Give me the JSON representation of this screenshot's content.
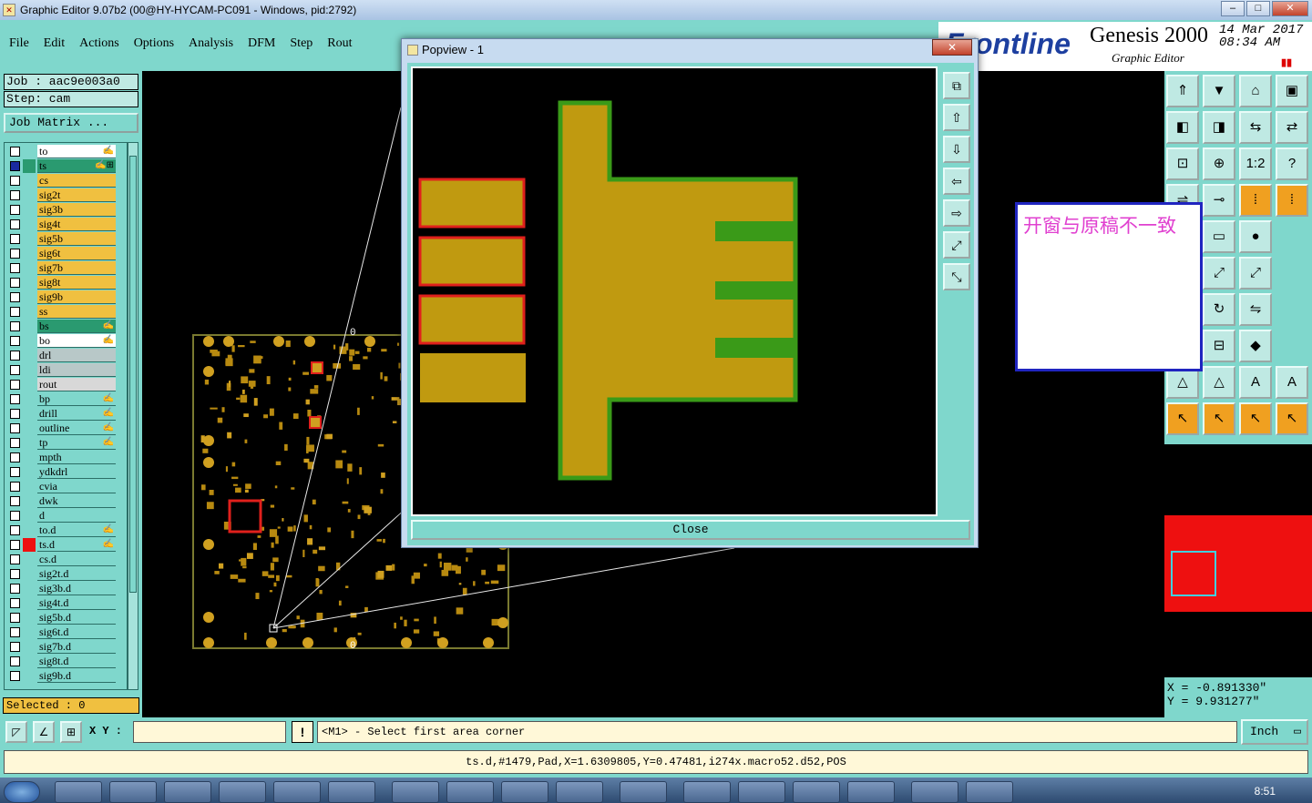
{
  "window": {
    "title": "Graphic Editor 9.07b2 (00@HY-HYCAM-PC091 - Windows, pid:2792)",
    "min_label": "–",
    "max_label": "□",
    "close_label": "✕"
  },
  "menu": {
    "items": [
      "File",
      "Edit",
      "Actions",
      "Options",
      "Analysis",
      "DFM",
      "Step",
      "Rout"
    ]
  },
  "brand": {
    "logo": "Frontline",
    "product": "Genesis 2000",
    "subtitle": "Graphic Editor",
    "date": "14 Mar 2017",
    "time": "08:34 AM"
  },
  "job": {
    "job_label": "Job : aac9e003a0",
    "step_label": "Step: cam",
    "matrix_button": "Job Matrix ..."
  },
  "layers": [
    {
      "name": "to",
      "bg": "#ffffff",
      "swatch": "",
      "checked": false,
      "mark": "✍"
    },
    {
      "name": "ts",
      "bg": "#2a9a70",
      "swatch": "#2a9a70",
      "checked": true,
      "mark": "✍⊞"
    },
    {
      "name": "cs",
      "bg": "#f0c040",
      "swatch": "",
      "checked": false,
      "mark": ""
    },
    {
      "name": "sig2t",
      "bg": "#f0c040",
      "swatch": "",
      "checked": false,
      "mark": ""
    },
    {
      "name": "sig3b",
      "bg": "#f0c040",
      "swatch": "",
      "checked": false,
      "mark": ""
    },
    {
      "name": "sig4t",
      "bg": "#f0c040",
      "swatch": "",
      "checked": false,
      "mark": ""
    },
    {
      "name": "sig5b",
      "bg": "#f0c040",
      "swatch": "",
      "checked": false,
      "mark": ""
    },
    {
      "name": "sig6t",
      "bg": "#f0c040",
      "swatch": "",
      "checked": false,
      "mark": ""
    },
    {
      "name": "sig7b",
      "bg": "#f0c040",
      "swatch": "",
      "checked": false,
      "mark": ""
    },
    {
      "name": "sig8t",
      "bg": "#f0c040",
      "swatch": "",
      "checked": false,
      "mark": ""
    },
    {
      "name": "sig9b",
      "bg": "#f0c040",
      "swatch": "",
      "checked": false,
      "mark": ""
    },
    {
      "name": "ss",
      "bg": "#f0c040",
      "swatch": "",
      "checked": false,
      "mark": ""
    },
    {
      "name": "bs",
      "bg": "#2a9a70",
      "swatch": "",
      "checked": false,
      "mark": "✍"
    },
    {
      "name": "bo",
      "bg": "#ffffff",
      "swatch": "",
      "checked": false,
      "mark": "✍"
    },
    {
      "name": "drl",
      "bg": "#b8c8c8",
      "swatch": "",
      "checked": false,
      "mark": ""
    },
    {
      "name": "ldi",
      "bg": "#b8c8c8",
      "swatch": "",
      "checked": false,
      "mark": ""
    },
    {
      "name": "rout",
      "bg": "#d8d8d8",
      "swatch": "",
      "checked": false,
      "mark": ""
    },
    {
      "name": "bp",
      "bg": "#7fd7cc",
      "swatch": "",
      "checked": false,
      "mark": "✍"
    },
    {
      "name": "drill",
      "bg": "#7fd7cc",
      "swatch": "",
      "checked": false,
      "mark": "✍"
    },
    {
      "name": "outline",
      "bg": "#7fd7cc",
      "swatch": "",
      "checked": false,
      "mark": "✍"
    },
    {
      "name": "tp",
      "bg": "#7fd7cc",
      "swatch": "",
      "checked": false,
      "mark": "✍"
    },
    {
      "name": "mpth",
      "bg": "#7fd7cc",
      "swatch": "",
      "checked": false,
      "mark": ""
    },
    {
      "name": "ydkdrl",
      "bg": "#7fd7cc",
      "swatch": "",
      "checked": false,
      "mark": ""
    },
    {
      "name": "cvia",
      "bg": "#7fd7cc",
      "swatch": "",
      "checked": false,
      "mark": ""
    },
    {
      "name": "dwk",
      "bg": "#7fd7cc",
      "swatch": "",
      "checked": false,
      "mark": ""
    },
    {
      "name": "d",
      "bg": "#7fd7cc",
      "swatch": "",
      "checked": false,
      "mark": ""
    },
    {
      "name": "to.d",
      "bg": "#7fd7cc",
      "swatch": "",
      "checked": false,
      "mark": "✍"
    },
    {
      "name": "ts.d",
      "bg": "#7fd7cc",
      "swatch": "#ee1010",
      "checked": false,
      "mark": "✍"
    },
    {
      "name": "cs.d",
      "bg": "#7fd7cc",
      "swatch": "",
      "checked": false,
      "mark": ""
    },
    {
      "name": "sig2t.d",
      "bg": "#7fd7cc",
      "swatch": "",
      "checked": false,
      "mark": ""
    },
    {
      "name": "sig3b.d",
      "bg": "#7fd7cc",
      "swatch": "",
      "checked": false,
      "mark": ""
    },
    {
      "name": "sig4t.d",
      "bg": "#7fd7cc",
      "swatch": "",
      "checked": false,
      "mark": ""
    },
    {
      "name": "sig5b.d",
      "bg": "#7fd7cc",
      "swatch": "",
      "checked": false,
      "mark": ""
    },
    {
      "name": "sig6t.d",
      "bg": "#7fd7cc",
      "swatch": "",
      "checked": false,
      "mark": ""
    },
    {
      "name": "sig7b.d",
      "bg": "#7fd7cc",
      "swatch": "",
      "checked": false,
      "mark": ""
    },
    {
      "name": "sig8t.d",
      "bg": "#7fd7cc",
      "swatch": "",
      "checked": false,
      "mark": ""
    },
    {
      "name": "sig9b.d",
      "bg": "#7fd7cc",
      "swatch": "",
      "checked": false,
      "mark": ""
    }
  ],
  "selected": "Selected : 0",
  "popup": {
    "title": "Popview - 1",
    "close_x": "✕",
    "close_button": "Close",
    "tools": [
      "zoom-fit-icon",
      "page-up-icon",
      "page-down-icon",
      "page-left-icon",
      "page-right-icon",
      "zoom-in-icon",
      "zoom-out-icon"
    ]
  },
  "board": {
    "origin_label_top": "0",
    "origin_label_bottom": "0"
  },
  "note": {
    "text": "开窗与原稿不一致"
  },
  "toolbar": {
    "icons": [
      "home-icon",
      "page-icon",
      "house-icon",
      "panel-icon",
      "move-left-icon",
      "move-right-icon",
      "step-icon",
      "swap-icon",
      "fit-icon",
      "center-icon",
      "one-to-one-icon",
      "help-icon",
      "filter-icon",
      "pad-icon",
      "measure-icon",
      "measure-red-icon",
      "line-icon",
      "ruler-icon",
      "dot-icon",
      "",
      "cross-icon",
      "snap-icon",
      "snap-blue-icon",
      "",
      "draw-line-icon",
      "rotate-icon",
      "mirror-icon",
      "",
      "minus-icon",
      "box-icon",
      "shape-icon",
      "",
      "triangle-icon",
      "triangle-up-icon",
      "a-icon",
      "a-right-icon",
      "pointer-icon",
      "pointer-box-icon",
      "pointer-circle-icon",
      "pointer-net-icon"
    ],
    "one_to_one_label": "1:2",
    "help_label": "?"
  },
  "coords": {
    "x": "X = -0.891330\"",
    "y": "Y = 9.931277\""
  },
  "cmd": {
    "xy_label": "X Y :",
    "xy_value": "",
    "excl": "!",
    "prompt": "<M1> - Select first area corner",
    "units": "Inch"
  },
  "status": {
    "text": "ts.d,#1479,Pad,X=1.6309805,Y=0.47481,i274x.macro52.d52,POS"
  },
  "taskbar": {
    "clock": "8:51"
  }
}
